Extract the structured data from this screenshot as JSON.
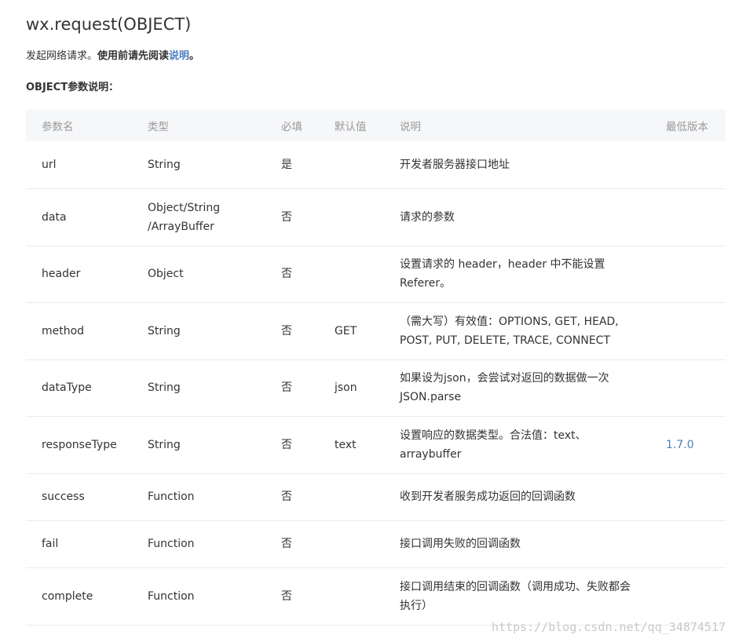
{
  "title": "wx.request(OBJECT)",
  "intro": {
    "prefix": "发起网络请求。",
    "bold": "使用前请先阅读",
    "link": "说明",
    "suffix": "。"
  },
  "section_title": "OBJECT参数说明：",
  "table": {
    "headers": [
      "参数名",
      "类型",
      "必填",
      "默认值",
      "说明",
      "最低版本"
    ],
    "rows": [
      {
        "name": "url",
        "type": "String",
        "required": "是",
        "default": "",
        "desc": "开发者服务器接口地址",
        "version": "",
        "height": 60
      },
      {
        "name": "data",
        "type": "Object/String /ArrayBuffer",
        "required": "否",
        "default": "",
        "desc": "请求的参数",
        "version": "",
        "height": 73
      },
      {
        "name": "header",
        "type": "Object",
        "required": "否",
        "default": "",
        "desc": "设置请求的 header，header 中不能设置 Referer。",
        "version": "",
        "height": 72
      },
      {
        "name": "method",
        "type": "String",
        "required": "否",
        "default": "GET",
        "desc": "（需大写）有效值：OPTIONS, GET, HEAD, POST, PUT, DELETE, TRACE, CONNECT",
        "version": "",
        "height": 73
      },
      {
        "name": "dataType",
        "type": "String",
        "required": "否",
        "default": "json",
        "desc": "如果设为json，会尝试对返回的数据做一次 JSON.parse",
        "version": "",
        "height": 72
      },
      {
        "name": "responseType",
        "type": "String",
        "required": "否",
        "default": "text",
        "desc": "设置响应的数据类型。合法值：text、arraybuffer",
        "version": "1.7.0",
        "height": 73
      },
      {
        "name": "success",
        "type": "Function",
        "required": "否",
        "default": "",
        "desc": "收到开发者服务成功返回的回调函数",
        "version": "",
        "height": 60
      },
      {
        "name": "fail",
        "type": "Function",
        "required": "否",
        "default": "",
        "desc": "接口调用失败的回调函数",
        "version": "",
        "height": 60
      },
      {
        "name": "complete",
        "type": "Function",
        "required": "否",
        "default": "",
        "desc": "接口调用结束的回调函数（调用成功、失败都会执行）",
        "version": "",
        "height": 73
      }
    ]
  },
  "watermark": "https://blog.csdn.net/qq_34874517"
}
